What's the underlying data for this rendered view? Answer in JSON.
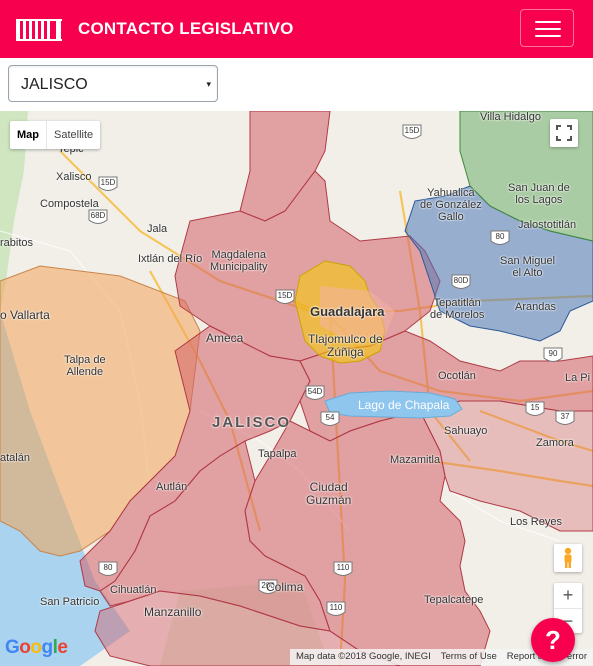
{
  "header": {
    "brand": "CONTACTO LEGISLATIVO",
    "menu_icon": "hamburger-icon",
    "logo_icon": "legislative-building-icon",
    "color": "#f7004e"
  },
  "state_select": {
    "value": "JALISCO",
    "arrow": "▾"
  },
  "map_controls": {
    "map_label": "Map",
    "satellite_label": "Satellite",
    "zoom_in": "+",
    "zoom_out": "−"
  },
  "map_labels": {
    "villa_hidalgo": "Villa Hidalgo",
    "tepic": "Tepic",
    "xalisco": "Xalisco",
    "compostela": "Compostela",
    "jala": "Jala",
    "rabitos": "rabitos",
    "ixtlan": "Ixtlán del Río",
    "magdalena": "Magdalena\nMunicipality",
    "yahualica": "Yahualica\nde González\nGallo",
    "san_juan": "San Juan de\nlos Lagos",
    "jalostotitlan": "Jalostotitlán",
    "san_miguel": "San Miguel\nel Alto",
    "tepatitlan": "Tepatitlán\nde Morelos",
    "arandas": "Arandas",
    "vallarta": "o Vallarta",
    "talpa": "Talpa de\nAllende",
    "ameca": "Ameca",
    "guadalajara": "Guadalajara",
    "tlajomulco": "Tlajomulco de\nZúñiga",
    "ocotlan": "Ocotlán",
    "la_pi": "La Pi",
    "lago": "Lago de Chapala",
    "jalisco": "JALISCO",
    "sahuayo": "Sahuayo",
    "zamora": "Zamora",
    "atalan": "atalán",
    "tapalpa": "Tapalpa",
    "mazamitla": "Mazamitla",
    "autlan": "Autlán",
    "ciudad_guzman": "Ciudad\nGuzmán",
    "los_reyes": "Los Reyes",
    "cihuatlan": "Cihuatlán",
    "san_patricio": "San Patricio",
    "manzanillo": "Manzanillo",
    "colima": "Colima",
    "tepalcatepec": "Tepalcatepe"
  },
  "highways": [
    "15D",
    "68D",
    "15D",
    "80",
    "80D",
    "90",
    "15D",
    "54D",
    "54",
    "15",
    "37",
    "110",
    "110",
    "80",
    "200"
  ],
  "attribution": {
    "map_data": "Map data ©2018 Google, INEGI",
    "terms": "Terms of Use",
    "report": "Report a map error"
  },
  "google_logo": "Google",
  "help_button": "?",
  "colors": {
    "district_red": "#d4606a",
    "district_orange": "#f2a45a",
    "district_yellow": "#f7d000",
    "district_blue": "#4d78b9",
    "district_green": "#6fae6b"
  }
}
